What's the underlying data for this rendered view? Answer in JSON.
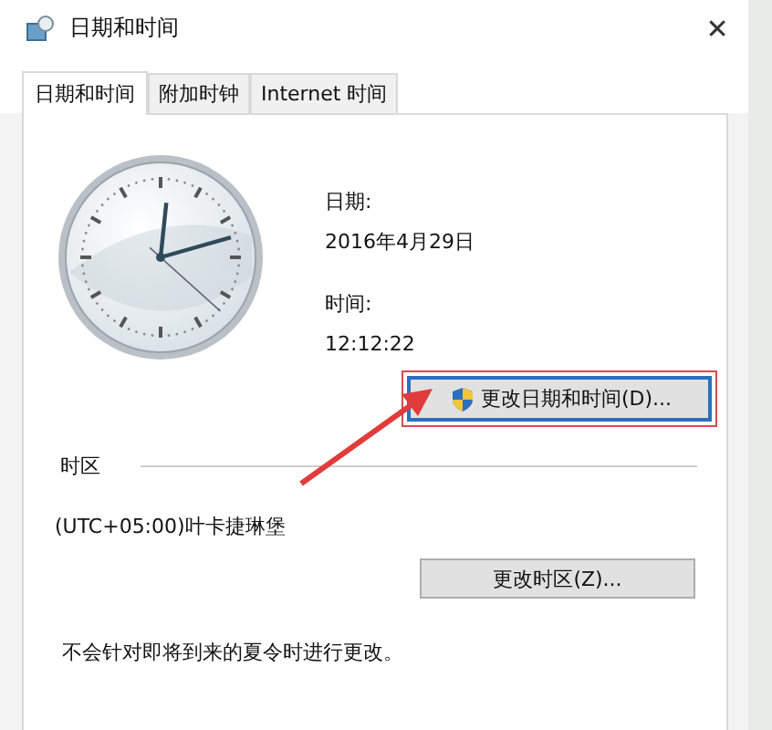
{
  "window": {
    "title": "日期和时间",
    "close": "✕"
  },
  "tabs": [
    {
      "label": "日期和时间",
      "selected": true
    },
    {
      "label": "附加时钟",
      "selected": false
    },
    {
      "label": "Internet 时间",
      "selected": false
    }
  ],
  "date_label": "日期:",
  "date": "2016年4月29日",
  "time_label": "时间:",
  "time": "12:12:22",
  "change_datetime_button": {
    "label": "更改日期和时间(D)...",
    "highlighted": true
  },
  "annotation_arrow": true,
  "timezone": {
    "heading": "时区",
    "value": "(UTC+05:00)叶卡捷琳堡",
    "button": "更改时区(Z)..."
  },
  "dst_note": "不会针对即将到来的夏令时进行更改。"
}
